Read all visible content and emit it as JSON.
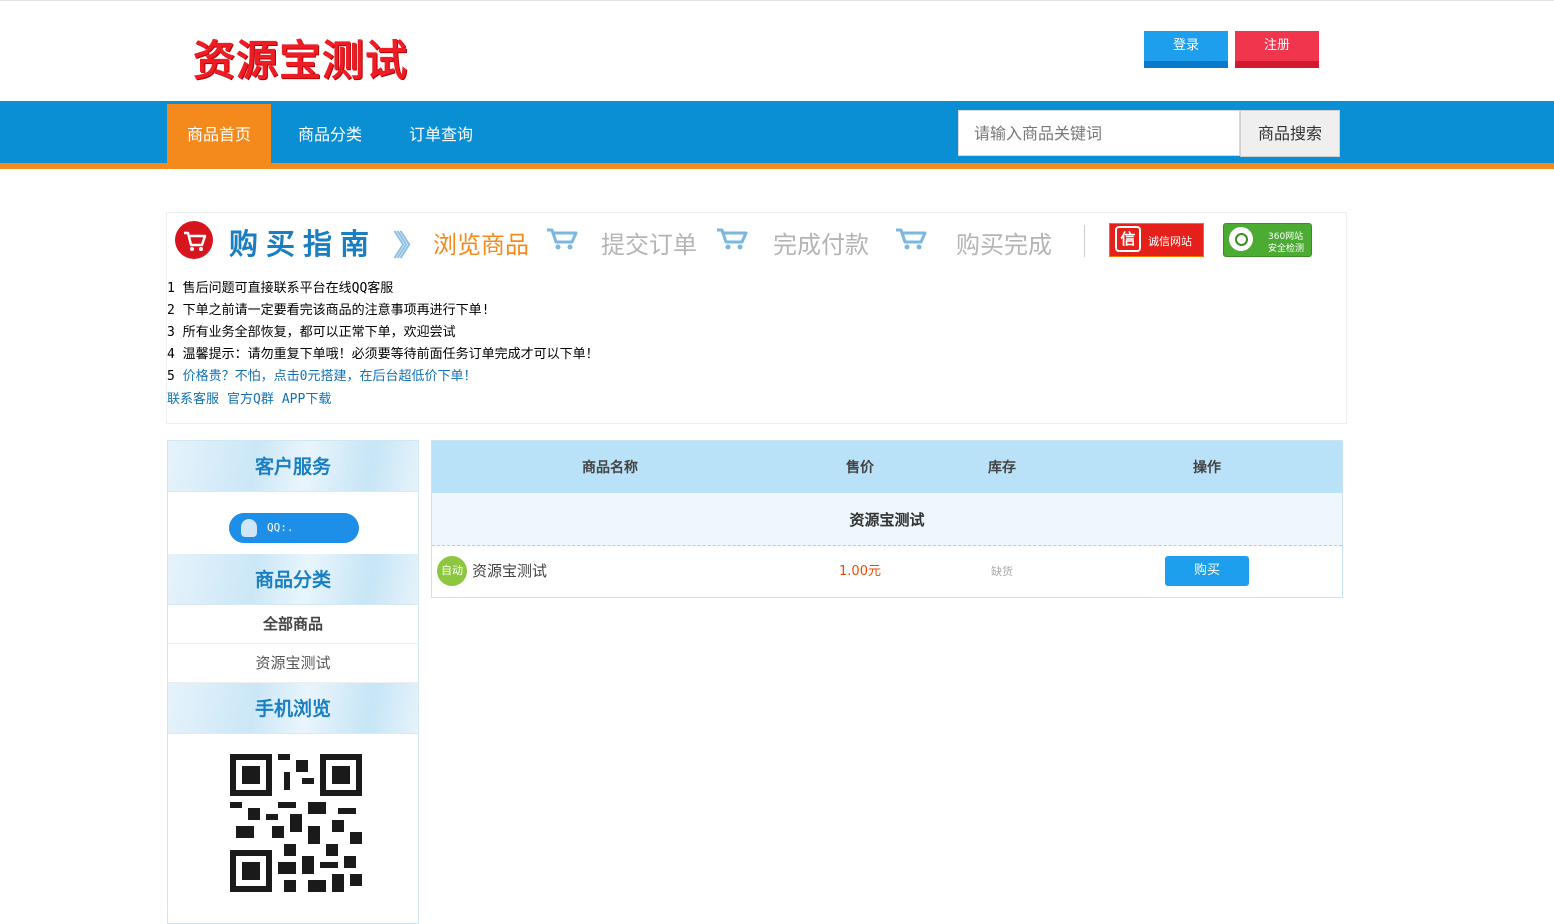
{
  "header": {
    "logo_text": "资源宝测试",
    "login_label": "登录",
    "register_label": "注册"
  },
  "nav": {
    "items": [
      {
        "label": "商品首页",
        "active": true
      },
      {
        "label": "商品分类",
        "active": false
      },
      {
        "label": "订单查询",
        "active": false
      }
    ],
    "search_placeholder": "请输入商品关键词",
    "search_button": "商品搜索"
  },
  "guide": {
    "title": "购买指南",
    "steps": [
      "浏览商品",
      "提交订单",
      "完成付款",
      "购买完成"
    ],
    "badge_chengxin": "诚信网站",
    "badge_360_line1": "360网站",
    "badge_360_line2": "安全检测",
    "notices": [
      "1 售后问题可直接联系平台在线QQ客服",
      "2 下单之前请一定要看完该商品的注意事项再进行下单!",
      "3 所有业务全部恢复，都可以正常下单，欢迎尝试",
      "4 温馨提示：请勿重复下单哦！必须要等待前面任务订单完成才可以下单！"
    ],
    "notice5_num": "5",
    "notice5_text": "价格贵？不怕，点击0元搭建，在后台超低价下单！",
    "links": [
      "联系客服",
      "官方Q群",
      "APP下载"
    ]
  },
  "sidebar": {
    "service_title": "客户服务",
    "qq_label": "QQ:.",
    "category_title": "商品分类",
    "categories": [
      "全部商品",
      "资源宝测试"
    ],
    "mobile_title": "手机浏览"
  },
  "table": {
    "headers": [
      "商品名称",
      "售价",
      "库存",
      "操作"
    ],
    "group_name": "资源宝测试",
    "rows": [
      {
        "badge": "自动",
        "name": "资源宝测试",
        "price": "1.00元",
        "stock": "缺货",
        "action": "购买"
      }
    ]
  },
  "colors": {
    "nav_blue": "#0a8fd4",
    "nav_orange": "#f58a1c",
    "login_blue": "#1e9fee",
    "register_red": "#f1354c",
    "logo_red": "#ee1c25"
  }
}
